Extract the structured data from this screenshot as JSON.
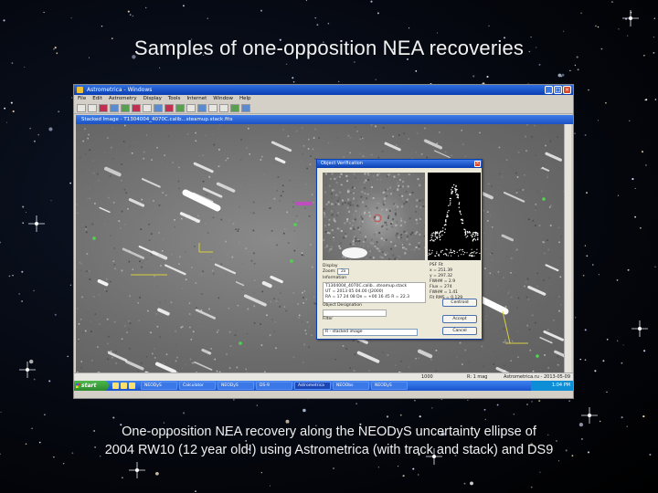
{
  "slide": {
    "title": "Samples of one-opposition NEA recoveries",
    "caption_line1": "One-opposition NEA recovery along the NEODyS uncertainty ellipse of",
    "caption_line2": "2004 RW10 (12 year old!) using Astrometrica (with track and stack) and DS9"
  },
  "screenshot": {
    "window_title": "Astrometrica - Windows",
    "menu": [
      "File",
      "Edit",
      "Astrometry",
      "Display",
      "Tools",
      "Internet",
      "Window",
      "Help"
    ],
    "child_title": "Stacked Image - T1304004_4070C.calib...steamup.stack.fits",
    "status": {
      "left": "1000",
      "mid": "R: 1 mag",
      "right": "Astrometrica.ru - 2013-05-09"
    },
    "taskbar": {
      "start_label": "start",
      "tasks": [
        "NEODyS",
        "Calculator",
        "NEODyS",
        "DS-9",
        "Astrometrica",
        "NEOObs",
        "NEODyS"
      ],
      "clock": "1:04 PM"
    }
  },
  "dialog": {
    "title": "Object Verification",
    "close_glyph": "×",
    "display_label": "Display",
    "zoom_label": "Zoom:",
    "zoom_value": "2x",
    "info_label": "Information",
    "info_lines": [
      "T1304004_4070C.calib...steamup.stack",
      "UT = 2013 05 04.00 (J2000)",
      "RA = 17 24 08   De = +00 16 45   R = 22.3"
    ],
    "designation_label": "Object Designation",
    "filter_label": "Filter",
    "filter_value": "R - stacked image",
    "psf_label": "PSF Fit",
    "psf_lines": [
      "x = 251.39",
      "y = 297.32",
      "FWHM = 2.9",
      "Flux = 274",
      "FWHM = 1.41",
      "Fit RMS = 0.129"
    ],
    "buttons": [
      "Centroid",
      "Accept",
      "Cancel"
    ],
    "colors": {
      "plot_bg": "#000000",
      "plot_points": "#ffffff"
    }
  },
  "colors": {
    "slide_bg": "#050810",
    "title_bar": "#0a3fb4",
    "start_button": "#2d8a2d",
    "marker_yellow": "#d8d040",
    "marker_green": "#4cd84c",
    "marker_magenta": "#d040d0"
  }
}
